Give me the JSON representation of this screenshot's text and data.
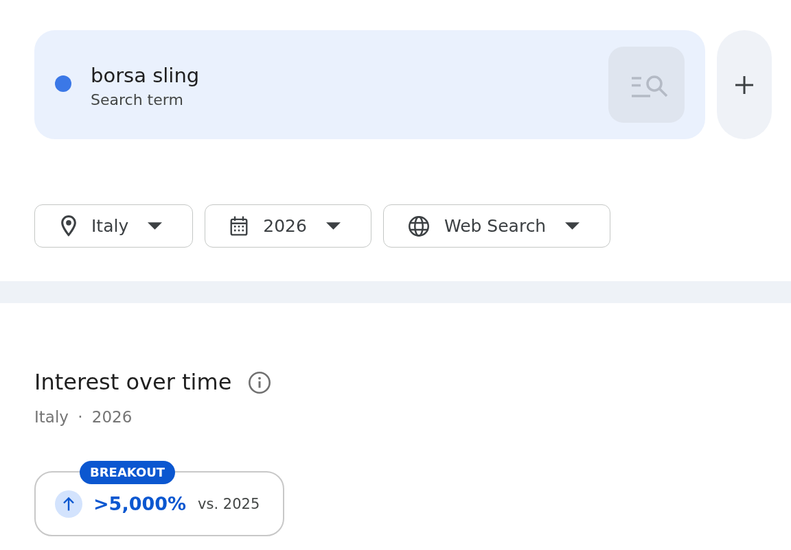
{
  "search_terms": [
    {
      "term": "borsa sling",
      "type": "Search term",
      "color": "#3b78e7",
      "compare_disabled": true
    }
  ],
  "filters": [
    {
      "kind": "location",
      "label": "Italy"
    },
    {
      "kind": "date",
      "label": "2026"
    },
    {
      "kind": "property",
      "label": "Web Search"
    }
  ],
  "interest_over_time": {
    "title": "Interest over time",
    "subtitle": "Italy · 2026",
    "breakout": {
      "badge": "BREAKOUT",
      "value": ">5,000%",
      "comparison": "vs. 2025"
    }
  }
}
